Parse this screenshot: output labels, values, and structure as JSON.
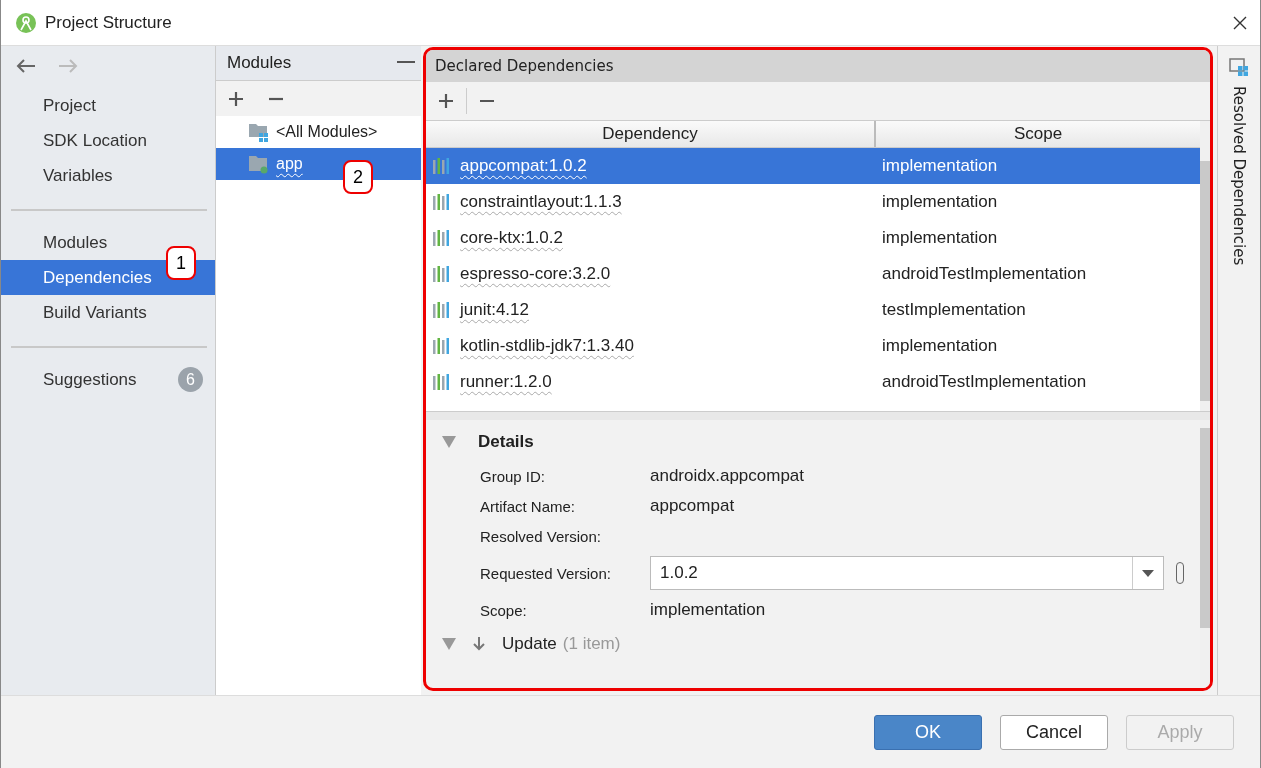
{
  "window": {
    "title": "Project Structure"
  },
  "sidebar": {
    "groups": [
      [
        {
          "label": "Project",
          "selected": false
        },
        {
          "label": "SDK Location",
          "selected": false
        },
        {
          "label": "Variables",
          "selected": false
        }
      ],
      [
        {
          "label": "Modules",
          "selected": false
        },
        {
          "label": "Dependencies",
          "selected": true,
          "callout": "1"
        },
        {
          "label": "Build Variants",
          "selected": false
        }
      ],
      [
        {
          "label": "Suggestions",
          "selected": false,
          "badge": "6"
        }
      ]
    ]
  },
  "modules_panel": {
    "title": "Modules",
    "items": [
      {
        "label": "<All Modules>",
        "kind": "all",
        "selected": false
      },
      {
        "label": "app",
        "kind": "module",
        "selected": true,
        "callout": "2"
      }
    ]
  },
  "dependencies": {
    "title": "Declared Dependencies",
    "columns": [
      "Dependency",
      "Scope"
    ],
    "rows": [
      {
        "dependency": "appcompat:1.0.2",
        "scope": "implementation",
        "selected": true
      },
      {
        "dependency": "constraintlayout:1.1.3",
        "scope": "implementation",
        "selected": false
      },
      {
        "dependency": "core-ktx:1.0.2",
        "scope": "implementation",
        "selected": false
      },
      {
        "dependency": "espresso-core:3.2.0",
        "scope": "androidTestImplementation",
        "selected": false
      },
      {
        "dependency": "junit:4.12",
        "scope": "testImplementation",
        "selected": false
      },
      {
        "dependency": "kotlin-stdlib-jdk7:1.3.40",
        "scope": "implementation",
        "selected": false
      },
      {
        "dependency": "runner:1.2.0",
        "scope": "androidTestImplementation",
        "selected": false
      }
    ]
  },
  "details": {
    "title": "Details",
    "expanded": true,
    "fields": [
      {
        "label": "Group ID:",
        "value": "androidx.appcompat"
      },
      {
        "label": "Artifact Name:",
        "value": "appcompat"
      },
      {
        "label": "Resolved Version:"
      },
      {
        "label": "Requested Version:",
        "kind": "combo",
        "value": "1.0.2"
      },
      {
        "label": "Scope:",
        "value": "implementation"
      }
    ]
  },
  "update": {
    "title": "Update",
    "count": "(1 item)",
    "expanded": true
  },
  "side_tab": {
    "label": "Resolved Dependencies"
  },
  "buttons": [
    {
      "label": "OK",
      "kind": "primary",
      "disabled": false
    },
    {
      "label": "Cancel",
      "kind": "normal",
      "disabled": false
    },
    {
      "label": "Apply",
      "kind": "normal",
      "disabled": true
    }
  ]
}
